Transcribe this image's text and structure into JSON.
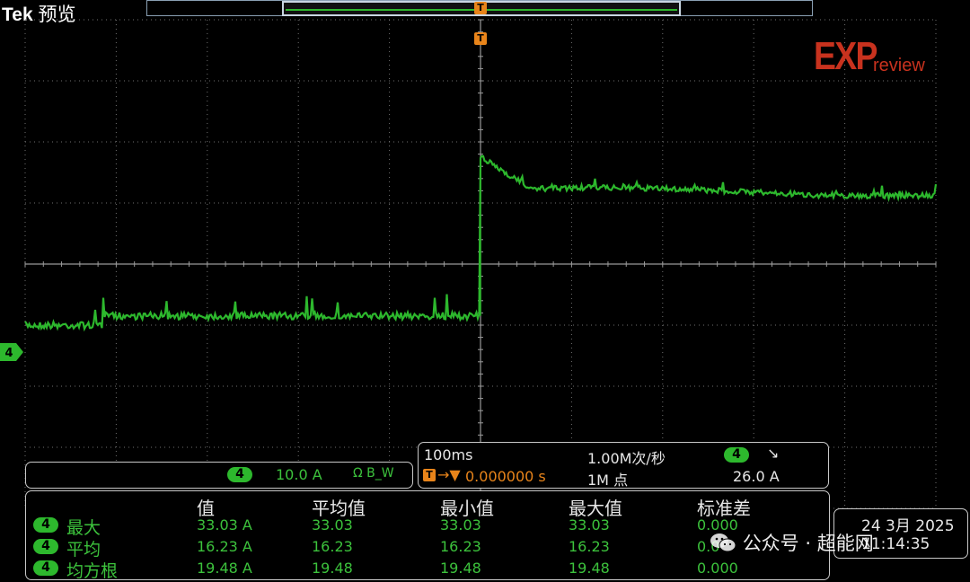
{
  "header": {
    "brand": "Tek",
    "mode": "预览"
  },
  "logo": {
    "main": "EXP",
    "sub": "review"
  },
  "colors": {
    "trace": "#2db82d",
    "grid": "#6f6f6f",
    "trigger": "#e8841a",
    "border": "#c8c8c8"
  },
  "trigger_marker": "T",
  "channel_marker": "4",
  "waveform": {
    "channel": "4",
    "trigger_time_fraction": 0.5,
    "level_before_pre": -1.0,
    "level_before": -0.85,
    "level_after_peak": 1.75,
    "level_after": 1.2,
    "units_per_div": "10.0 A"
  },
  "channel_box": {
    "channel": "4",
    "scale": "10.0 A",
    "bw_icon": "Ω B_W"
  },
  "acq_box": {
    "timebase": "100ms",
    "sample_rate": "1.00M次/秒",
    "trig_channel": "4",
    "trig_slope": "↘",
    "trig_pos": "0.000000 s",
    "record_length": "1M 点",
    "trig_level": "26.0 A"
  },
  "measurements": {
    "headers": [
      "值",
      "平均值",
      "最小值",
      "最大值",
      "标准差"
    ],
    "rows": [
      {
        "channel": "4",
        "label": "最大",
        "value": "33.03 A",
        "mean": "33.03",
        "min": "33.03",
        "max": "33.03",
        "std": "0.000"
      },
      {
        "channel": "4",
        "label": "平均",
        "value": "16.23 A",
        "mean": "16.23",
        "min": "16.23",
        "max": "16.23",
        "std": "0.0"
      },
      {
        "channel": "4",
        "label": "均方根",
        "value": "19.48 A",
        "mean": "19.48",
        "min": "19.48",
        "max": "19.48",
        "std": "0.000"
      }
    ]
  },
  "datetime": {
    "date": "24 3月 2025",
    "time": "11:14:35"
  },
  "watermark": {
    "text": "公众号 · 超能网"
  }
}
